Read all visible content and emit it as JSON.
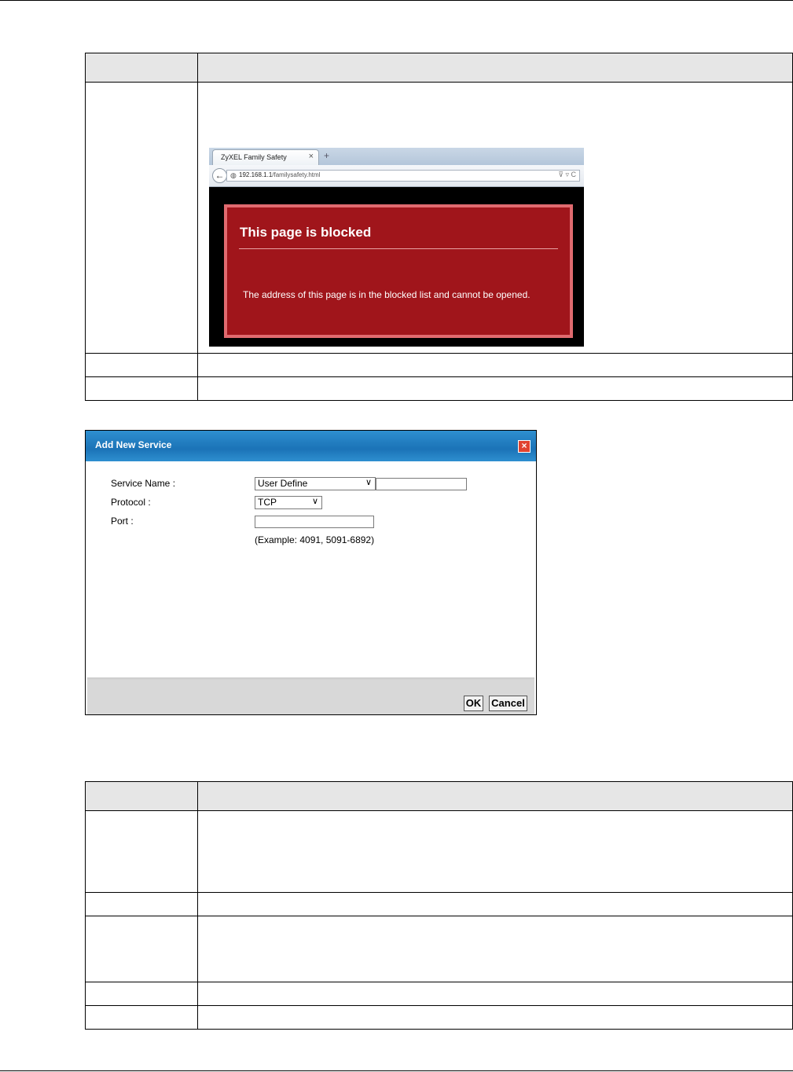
{
  "browser": {
    "tab_title": "ZyXEL Family Safety",
    "tab_close": "×",
    "new_tab": "+",
    "back": "←",
    "url_host": "192.168.1.1",
    "url_path": "/familysafety.html",
    "url_controls": "⊽ ▿ C",
    "blocked_title": "This page is blocked",
    "blocked_message": "The address of this page is in the blocked list and cannot be opened."
  },
  "dialog": {
    "title": "Add New Service",
    "close": "×",
    "fields": {
      "service_name_label": "Service Name :",
      "service_name_value": "User Define",
      "protocol_label": "Protocol :",
      "protocol_value": "TCP",
      "port_label": "Port :",
      "port_example": "(Example: 4091, 5091-6892)"
    },
    "buttons": {
      "ok": "OK",
      "cancel": "Cancel"
    }
  }
}
